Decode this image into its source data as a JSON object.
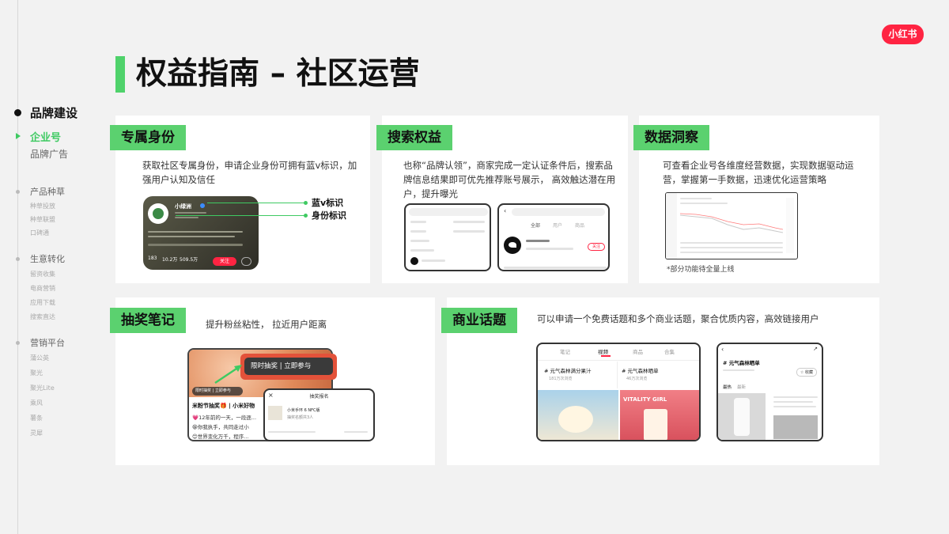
{
  "logo_text": "小红书",
  "title": "权益指南 – 社区运营",
  "sidebar": {
    "section": "品牌建设",
    "active": "企业号",
    "items": [
      "品牌广告"
    ],
    "groups": [
      {
        "label": "产品种草",
        "subs": [
          "种草投放",
          "种草联盟",
          "口碑通"
        ]
      },
      {
        "label": "生意转化",
        "subs": [
          "留资收集",
          "电商营销",
          "应用下载",
          "搜索直达"
        ]
      },
      {
        "label": "营销平台",
        "subs": [
          "蒲公英",
          "聚光",
          "聚光Lite",
          "乘风",
          "薯条",
          "灵犀"
        ]
      }
    ]
  },
  "cards": {
    "identity": {
      "tag": "专属身份",
      "desc": "获取社区专属身份，申请企业身份可拥有蓝v标识，加强用户认知及信任",
      "callout_blue": "蓝v标识",
      "callout_id": "身份标识",
      "profile_name": "小绿洲",
      "stats": [
        "183",
        "10.2万",
        "509.5万"
      ],
      "follow_label": "关注"
    },
    "search": {
      "tag": "搜索权益",
      "desc": "也称“品牌认领”，商家完成一定认证条件后，搜索品牌信息结果即可优先推荐账号展示， 高效触达潜在用户，提升曝光",
      "result_tabs": [
        "全部",
        "用户",
        "商品"
      ],
      "follow_label": "关注"
    },
    "data": {
      "tag": "数据洞察",
      "desc": "可查看企业号各维度经营数据，实现数据驱动运营，掌握第一手数据，迅速优化运营策略",
      "note": "*部分功能待全量上线"
    },
    "lottery": {
      "tag": "抽奖笔记",
      "desc": "提升粉丝粘性， 拉近用户距离",
      "badge_big": "限时抽奖 | 立即参与",
      "badge_small": "限时抽奖 | 立即参与",
      "note_title": "米粉节抽奖🎁 | 小米好物",
      "note_lines": [
        "💗12年前的一天，一段逐...",
        "😁你我执手，共同走过小",
        "😊世界变化万千，程序..."
      ],
      "popup_title": "抽奖报名",
      "popup_item": "小米手环 6 NFC版",
      "popup_sub": "抽奖名额共3人"
    },
    "topic": {
      "tag": "商业话题",
      "desc": "可以申请一个免费话题和多个商业话题，聚合优质内容，高效链接用户",
      "tabs": [
        "笔记",
        "视频",
        "商品",
        "合集"
      ],
      "active_tab": "视频",
      "topics": [
        "# 元气森林满分果汁",
        "# 元气森林晒单"
      ],
      "topic_views": [
        "181万次浏览",
        "46万次浏览"
      ],
      "banner_text": "VITALITY GIRL",
      "right_title": "# 元气森林晒单",
      "right_tabs": [
        "最热",
        "最新"
      ],
      "right_follow": "☆ 收藏"
    }
  }
}
